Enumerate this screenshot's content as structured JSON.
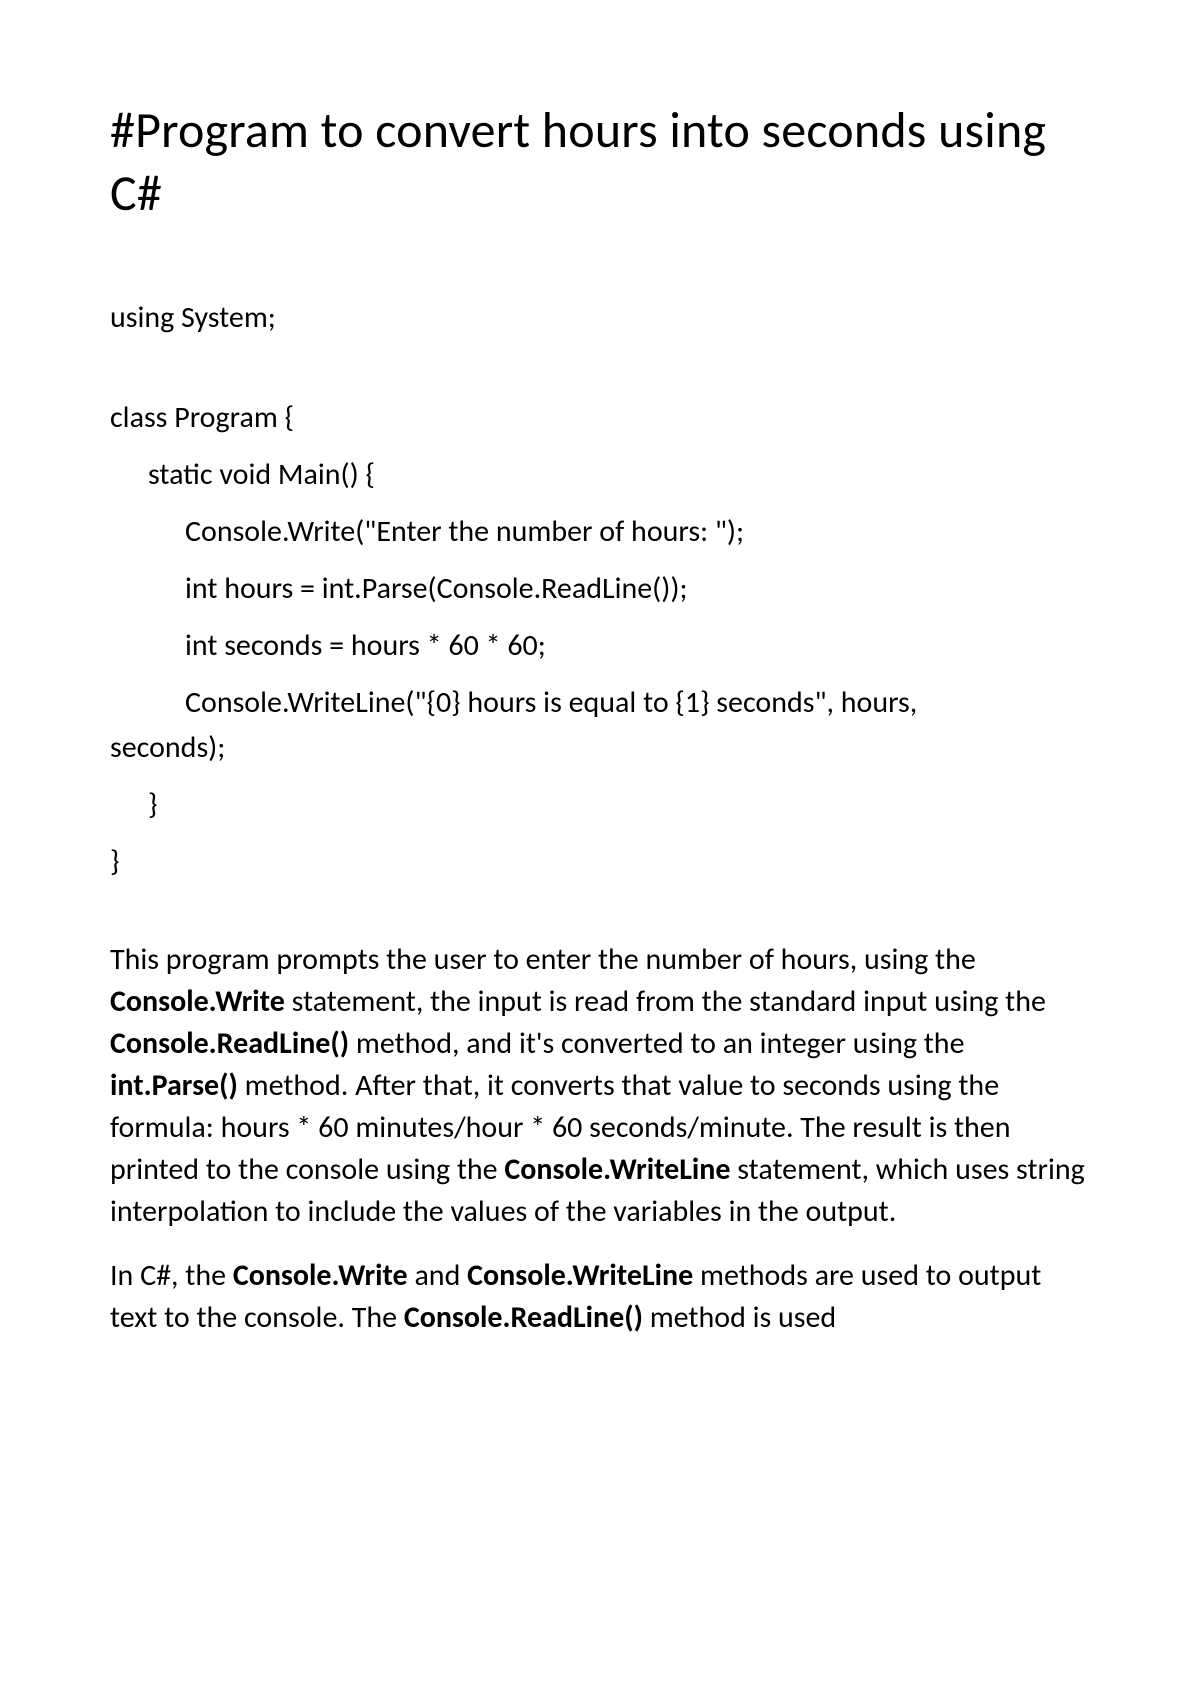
{
  "title": "#Program to convert hours into seconds using C#",
  "code": {
    "line0": "using System;",
    "line1": "class Program {",
    "line2": "static void Main() {",
    "line3": "Console.Write(\"Enter the number of hours: \");",
    "line4": "int hours = int.Parse(Console.ReadLine());",
    "line5": "int seconds = hours * 60 * 60;",
    "line6": "Console.WriteLine(\"{0} hours is equal to {1} seconds\", hours,",
    "line6b": "seconds);",
    "line7": "}",
    "line8": "}"
  },
  "para1": {
    "t1": "This program prompts the user to enter the number of hours, using the ",
    "b1": "Console.Write",
    "t2": " statement, the input is read from the standard input using the ",
    "b2": "Console.ReadLine()",
    "t3": " method, and it's converted to an integer using the ",
    "b3": "int.Parse()",
    "t4": " method. After that, it converts that value to seconds using the formula: hours * 60 minutes/hour * 60 seconds/minute. The result is then printed to the console using the ",
    "b4": "Console.WriteLine",
    "t5": " statement, which uses string interpolation to include the values of the variables in the output."
  },
  "para2": {
    "t1": "In C#, the ",
    "b1": "Console.Write",
    "t2": " and ",
    "b2": "Console.WriteLine",
    "t3": " methods are used to output text to the console. The ",
    "b3": "Console.ReadLine()",
    "t4": " method is used"
  }
}
